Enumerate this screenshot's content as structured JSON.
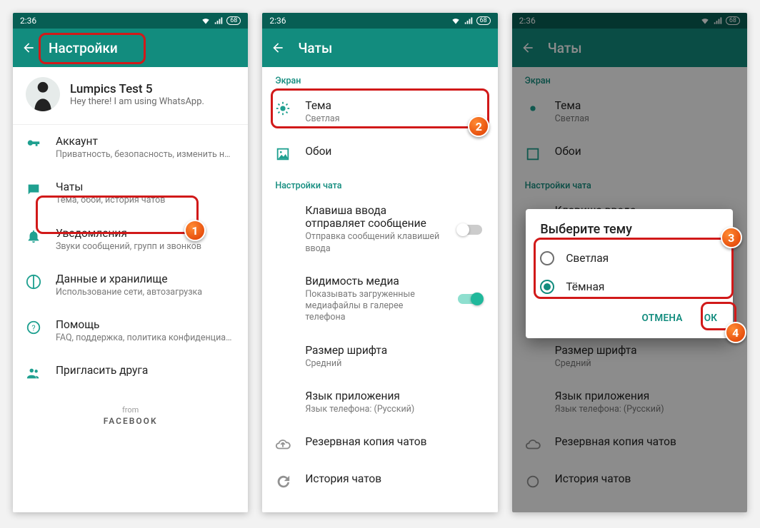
{
  "statusbar": {
    "time": "2:36",
    "battery": "68"
  },
  "screen1": {
    "appbar_title": "Настройки",
    "profile_name": "Lumpics Test 5",
    "profile_status": "Hey there! I am using WhatsApp.",
    "items": [
      {
        "title": "Аккаунт",
        "subtitle": "Приватность, безопасность, изменить номер"
      },
      {
        "title": "Чаты",
        "subtitle": "Тема, обои, история чатов"
      },
      {
        "title": "Уведомления",
        "subtitle": "Звуки сообщений, групп и звонков"
      },
      {
        "title": "Данные и хранилище",
        "subtitle": "Использование сети, автозагрузка"
      },
      {
        "title": "Помощь",
        "subtitle": "FAQ, поддержка, политика конфиденциальн..."
      },
      {
        "title": "Пригласить друга",
        "subtitle": ""
      }
    ],
    "from_label": "from",
    "facebook_label": "FACEBOOK"
  },
  "screen2": {
    "appbar_title": "Чаты",
    "section_screen": "Экран",
    "theme_title": "Тема",
    "theme_value": "Светлая",
    "wallpaper": "Обои",
    "section_chat": "Настройки чата",
    "enter_title": "Клавиша ввода отправляет сообщение",
    "enter_sub": "Отправка сообщений клавишей ввода",
    "media_title": "Видимость медиа",
    "media_sub": "Показывать загруженные медиафайлы в галерее телефона",
    "font_title": "Размер шрифта",
    "font_value": "Средний",
    "lang_title": "Язык приложения",
    "lang_value": "Язык телефона: (Русский)",
    "backup": "Резервная копия чатов",
    "history": "История чатов"
  },
  "dialog": {
    "title": "Выберите тему",
    "opt_light": "Светлая",
    "opt_dark": "Тёмная",
    "cancel": "ОТМЕНА",
    "ok": "ОК"
  }
}
